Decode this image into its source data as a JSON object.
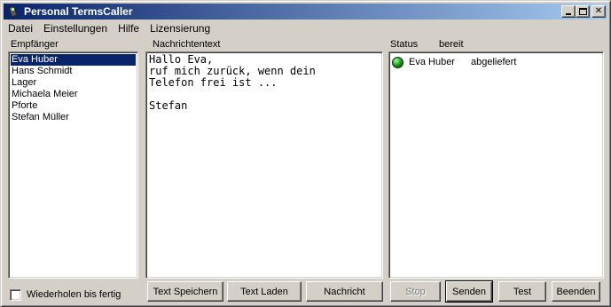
{
  "window": {
    "title": "Personal TermsCaller"
  },
  "menu": [
    "Datei",
    "Einstellungen",
    "Hilfe",
    "Lizensierung"
  ],
  "recipients": {
    "label": "Empfänger",
    "items": [
      "Eva Huber",
      "Hans Schmidt",
      "Lager",
      "Michaela Meier",
      "Pforte",
      "Stefan Müller"
    ],
    "selected": "Eva Huber"
  },
  "message": {
    "label": "Nachrichtentext",
    "text": "Hallo Eva,\nruf mich zurück, wenn dein\nTelefon frei ist ...\n\nStefan"
  },
  "status": {
    "label": "Status",
    "value": "bereit",
    "rows": [
      {
        "name": "Eva Huber",
        "state": "abgeliefert",
        "indicator": "green"
      }
    ]
  },
  "repeat_checkbox": {
    "label": "Wiederholen bis fertig",
    "checked": false
  },
  "buttons": {
    "save_text": "Text Speichern",
    "load_text": "Text Laden",
    "message": "Nachricht",
    "stop": "Stop",
    "send": "Senden",
    "test": "Test",
    "quit": "Beenden"
  },
  "colors": {
    "titlebar": "#0a246a",
    "selection": "#0a246a",
    "status_ok": "#1a8a1a"
  }
}
